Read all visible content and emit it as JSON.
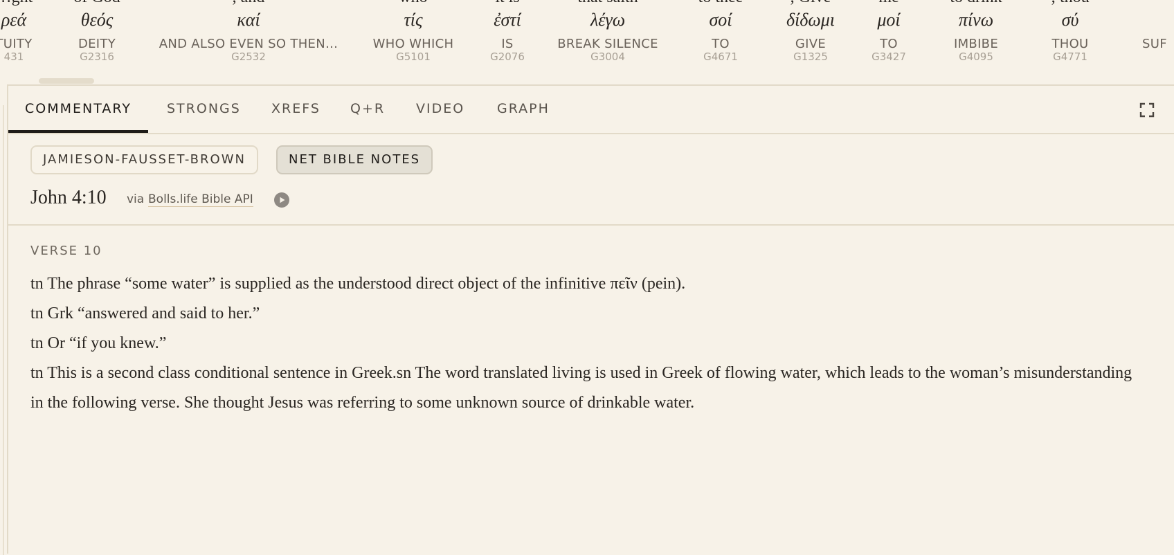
{
  "interlinear": {
    "words": [
      {
        "english": "…ght",
        "greek": "ρεά",
        "gloss": "TUITY",
        "strong": "431"
      },
      {
        "english": "of God",
        "greek": "θεός",
        "gloss": "DEITY",
        "strong": "G2316"
      },
      {
        "english": ", and",
        "greek": "καί",
        "gloss": "AND ALSO EVEN SO THEN…",
        "strong": "G2532"
      },
      {
        "english": "who",
        "greek": "τίς",
        "gloss": "WHO WHICH",
        "strong": "G5101"
      },
      {
        "english": "it is",
        "greek": "ἐστί",
        "gloss": "IS",
        "strong": "G2076"
      },
      {
        "english": "that saith",
        "greek": "λέγω",
        "gloss": "BREAK SILENCE",
        "strong": "G3004"
      },
      {
        "english": "to thee",
        "greek": "σοί",
        "gloss": "TO",
        "strong": "G4671"
      },
      {
        "english": ", Give",
        "greek": "δίδωμι",
        "gloss": "GIVE",
        "strong": "G1325"
      },
      {
        "english": "me",
        "greek": "μοί",
        "gloss": "TO",
        "strong": "G3427"
      },
      {
        "english": "to drink",
        "greek": "πίνω",
        "gloss": "IMBIBE",
        "strong": "G4095"
      },
      {
        "english": "; thou",
        "greek": "σύ",
        "gloss": "THOU",
        "strong": "G4771"
      },
      {
        "english": "",
        "greek": "",
        "gloss": "SUF",
        "strong": ""
      }
    ]
  },
  "tabs": [
    {
      "label": "COMMENTARY",
      "active": true
    },
    {
      "label": "STRONGS",
      "active": false
    },
    {
      "label": "XREFS",
      "active": false
    },
    {
      "label": "Q+R",
      "active": false
    },
    {
      "label": "VIDEO",
      "active": false
    },
    {
      "label": "GRAPH",
      "active": false
    }
  ],
  "sources": [
    {
      "label": "JAMIESON-FAUSSET-BROWN",
      "selected": false
    },
    {
      "label": "NET BIBLE NOTES",
      "selected": true
    }
  ],
  "reference": {
    "title": "John 4:10",
    "via": "via",
    "source_link": "Bolls.life Bible API"
  },
  "notes": {
    "verse_label": "VERSE 10",
    "items": [
      "tn The phrase “some water” is supplied as the understood direct object of the infinitive πεῖν (pein).",
      "tn Grk “answered and said to her.”",
      "tn Or “if you knew.”",
      "tn This is a second class conditional sentence in Greek.sn The word translated living is used in Greek of flowing water, which leads to the woman’s misunderstanding in the following verse. She thought Jesus was referring to some unknown source of drinkable water."
    ]
  },
  "icons": {
    "expand": "expand-icon",
    "play": "play-circle-icon"
  },
  "colors": {
    "background": "#f7f2e8",
    "border": "#e2dac8",
    "active_tab": "#1f1c19",
    "selected_source": "#e4e0d5"
  }
}
